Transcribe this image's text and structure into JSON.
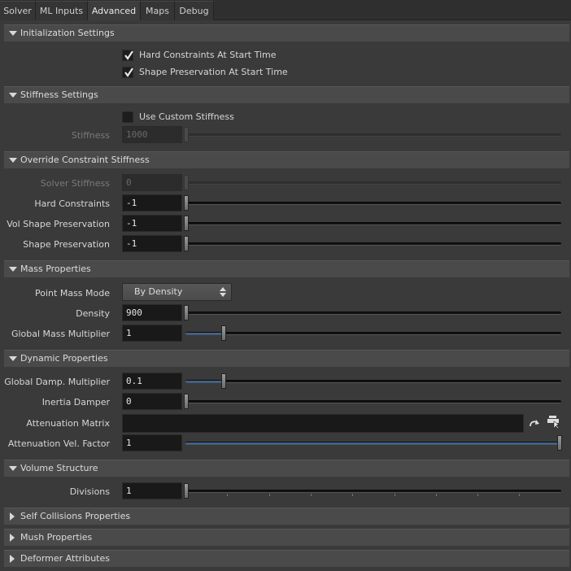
{
  "tabs": [
    {
      "label": "Solver",
      "active": false
    },
    {
      "label": "ML Inputs",
      "active": false
    },
    {
      "label": "Advanced",
      "active": true
    },
    {
      "label": "Maps",
      "active": false
    },
    {
      "label": "Debug",
      "active": false
    }
  ],
  "init": {
    "title": "Initialization Settings",
    "hard_constraints": {
      "label": "Hard Constraints At Start Time",
      "checked": true
    },
    "shape_preservation": {
      "label": "Shape Preservation At Start Time",
      "checked": true
    }
  },
  "stiffness": {
    "title": "Stiffness Settings",
    "use_custom": {
      "label": "Use Custom Stiffness",
      "checked": false
    },
    "stiffness_label": "Stiffness",
    "stiffness_value": "1000"
  },
  "override": {
    "title": "Override Constraint Stiffness",
    "solver": {
      "label": "Solver Stiffness",
      "value": "0"
    },
    "hard": {
      "label": "Hard Constraints",
      "value": "-1"
    },
    "vol_shape": {
      "label": "Vol Shape Preservation",
      "value": "-1"
    },
    "shape": {
      "label": "Shape Preservation",
      "value": "-1"
    }
  },
  "mass": {
    "title": "Mass Properties",
    "mode_label": "Point Mass Mode",
    "mode_value": "By Density",
    "density": {
      "label": "Density",
      "value": "900"
    },
    "global_mult": {
      "label": "Global Mass Multiplier",
      "value": "1",
      "fill": 0.1
    }
  },
  "dynamic": {
    "title": "Dynamic Properties",
    "damp": {
      "label": "Global Damp. Multiplier",
      "value": "0.1",
      "fill": 0.1
    },
    "inertia": {
      "label": "Inertia Damper",
      "value": "0"
    },
    "atten_matrix": {
      "label": "Attenuation Matrix",
      "value": ""
    },
    "atten_vel": {
      "label": "Attenuation Vel. Factor",
      "value": "1",
      "fill": 1.0
    }
  },
  "volume": {
    "title": "Volume Structure",
    "divisions": {
      "label": "Divisions",
      "value": "1"
    }
  },
  "collapsed": {
    "self_collisions": "Self Collisions Properties",
    "mush": "Mush Properties",
    "deformer": "Deformer Attributes"
  },
  "colors": {
    "accent": "#2f67a8",
    "background": "#3a3a3a",
    "header": "#4a4a4a"
  }
}
